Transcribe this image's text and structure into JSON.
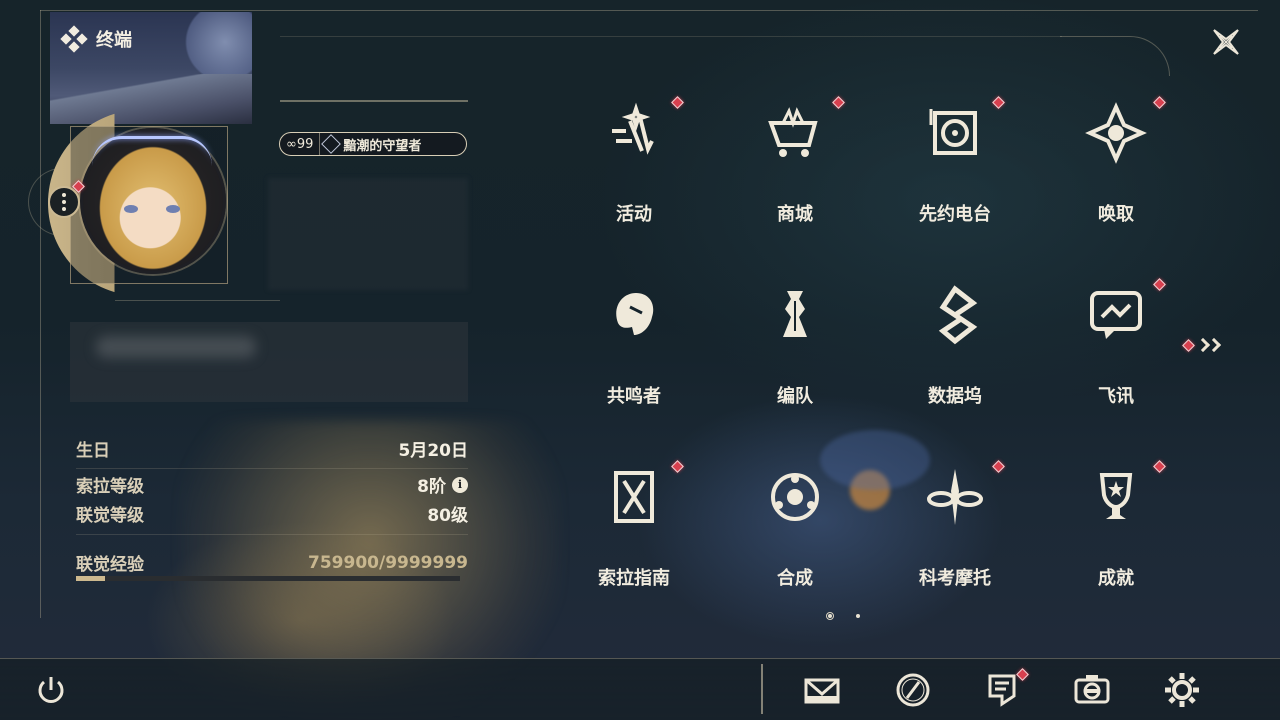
{
  "header": {
    "terminal_label": "终端"
  },
  "profile": {
    "title_count": "∞99",
    "title_name": "黯潮的守望者",
    "stats": [
      {
        "label": "生日",
        "value": "5月20日"
      },
      {
        "label": "索拉等级",
        "value": "8阶"
      },
      {
        "label": "联觉等级",
        "value": "80级"
      }
    ],
    "exp_label": "联觉经验",
    "exp_value": "759900/9999999",
    "exp_progress": 0.076
  },
  "features": [
    {
      "label": "活动",
      "icon": "activity-icon",
      "badge": true
    },
    {
      "label": "商城",
      "icon": "shop-cart-icon",
      "badge": true
    },
    {
      "label": "先约电台",
      "icon": "radio-icon",
      "badge": true
    },
    {
      "label": "唤取",
      "icon": "convene-icon",
      "badge": true
    },
    {
      "label": "共鸣者",
      "icon": "resonator-icon",
      "badge": false
    },
    {
      "label": "编队",
      "icon": "team-chess-icon",
      "badge": false
    },
    {
      "label": "数据坞",
      "icon": "data-dock-icon",
      "badge": false
    },
    {
      "label": "飞讯",
      "icon": "chat-icon",
      "badge": true
    },
    {
      "label": "索拉指南",
      "icon": "guidebook-icon",
      "badge": true
    },
    {
      "label": "合成",
      "icon": "synthesis-icon",
      "badge": false
    },
    {
      "label": "科考摩托",
      "icon": "motorbike-icon",
      "badge": true
    },
    {
      "label": "成就",
      "icon": "trophy-icon",
      "badge": true
    }
  ],
  "bottom_bar": [
    {
      "name": "mail-icon"
    },
    {
      "name": "clock-icon"
    },
    {
      "name": "notice-icon",
      "badge": true
    },
    {
      "name": "camera-icon"
    },
    {
      "name": "settings-gear-icon"
    }
  ],
  "colors": {
    "accent_gold": "#cdb98f",
    "badge_red": "#d8404f",
    "text_light": "#f1ecdf"
  }
}
